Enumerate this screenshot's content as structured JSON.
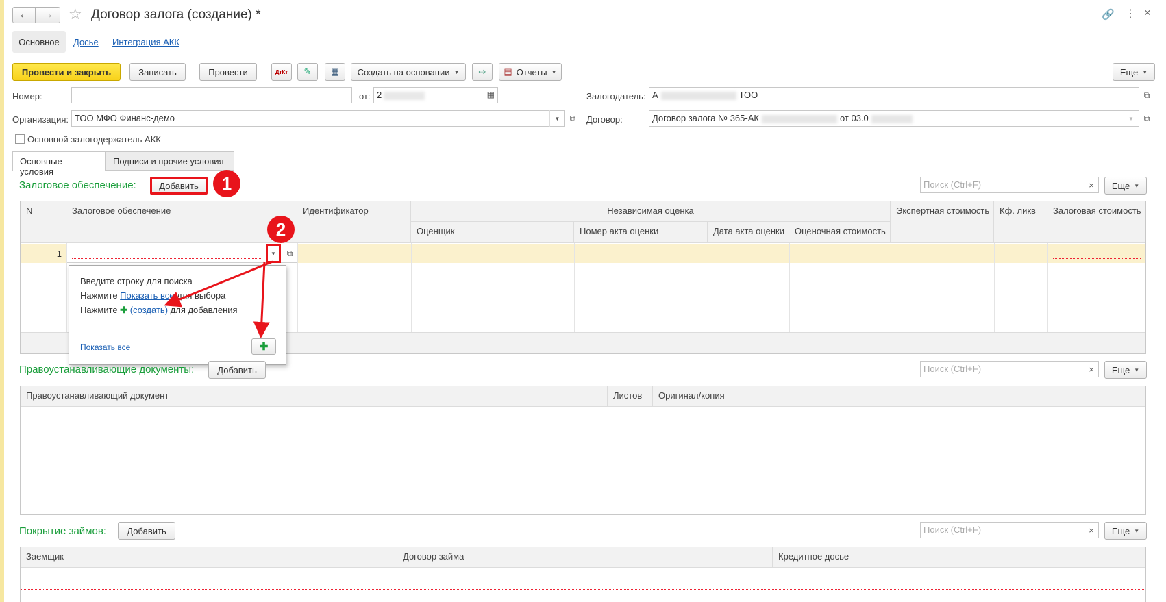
{
  "window": {
    "title": "Договор залога (создание) *"
  },
  "nav_tabs": [
    "Основное",
    "Досье",
    "Интеграция АКК"
  ],
  "toolbar": {
    "post_close": "Провести и закрыть",
    "save": "Записать",
    "post": "Провести",
    "create_based": "Создать на основании",
    "reports": "Отчеты",
    "more": "Еще"
  },
  "header": {
    "number_label": "Номер:",
    "number_value": "",
    "date_label": "от:",
    "date_value": "2",
    "org_label": "Организация:",
    "org_value": "ТОО МФО Финанс-демо",
    "pledger_label": "Залогодатель:",
    "pledger_value": "А",
    "pledger_suffix": "ТОО",
    "contract_label": "Договор:",
    "contract_value": "Договор залога № 365-АК",
    "contract_suffix": "от 03.0",
    "main_holder_label": "Основной залогодержатель АКК"
  },
  "form_tabs": [
    "Основные условия",
    "Подписи  и прочие условия"
  ],
  "collateral": {
    "title": "Залоговое обеспечение:",
    "add": "Добавить",
    "search_placeholder": "Поиск (Ctrl+F)",
    "more": "Еще",
    "columns": {
      "n": "N",
      "collateral": "Залоговое обеспечение",
      "identifier": "Идентификатор",
      "independent": "Независимая оценка",
      "appraiser": "Оценщик",
      "act_number": "Номер акта оценки",
      "act_date": "Дата акта оценки",
      "appraised": "Оценочная стоимость",
      "expert": "Экспертная стоимость",
      "liq": "Кф. ликв",
      "pledge_value": "Залоговая стоимость"
    },
    "row_n": "1"
  },
  "dropdown": {
    "line1": "Введите строку для поиска",
    "line2_pre": "Нажмите ",
    "line2_link": "Показать все",
    "line2_post": " для выбора",
    "line3_pre": "Нажмите ",
    "line3_link": "(создать)",
    "line3_post": " для добавления",
    "show_all": "Показать все"
  },
  "title_docs": {
    "title": "Правоустанавливающие документы:",
    "add": "Добавить",
    "search_placeholder": "Поиск (Ctrl+F)",
    "more": "Еще",
    "columns": [
      "Правоустанавливающий документ",
      "Листов",
      "Оригинал/копия"
    ]
  },
  "loans": {
    "title": "Покрытие займов:",
    "add": "Добавить",
    "search_placeholder": "Поиск (Ctrl+F)",
    "more": "Еще",
    "columns": [
      "Заемщик",
      "Договор займа",
      "Кредитное досье"
    ]
  },
  "callouts": [
    "1",
    "2"
  ],
  "colors": {
    "accent_yellow": "#f8d21b",
    "section_green": "#1a9e3b",
    "callout_red": "#e8141b",
    "row_highlight": "#fbf1cd"
  }
}
